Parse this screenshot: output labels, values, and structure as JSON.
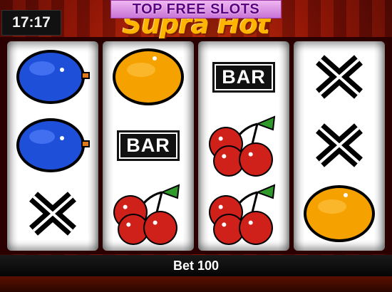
{
  "status": {
    "clock": "17:17"
  },
  "promo": {
    "banner_text": "TOP FREE SLOTS"
  },
  "game": {
    "logo_text": "Supra Hot"
  },
  "reels": [
    [
      "plum",
      "plum",
      "cross"
    ],
    [
      "orange",
      "bar",
      "cherries"
    ],
    [
      "bar",
      "cherries",
      "cherries"
    ],
    [
      "cross",
      "cross",
      "orange"
    ]
  ],
  "symbols": {
    "bar_label": "BAR"
  },
  "footer": {
    "bet_label": "Bet 100"
  },
  "colors": {
    "plum": "#1e4fd8",
    "orange": "#f5a100",
    "cherry": "#d0201a",
    "leaf": "#2f9a2a",
    "promo_bg": "#e6a2ec"
  }
}
